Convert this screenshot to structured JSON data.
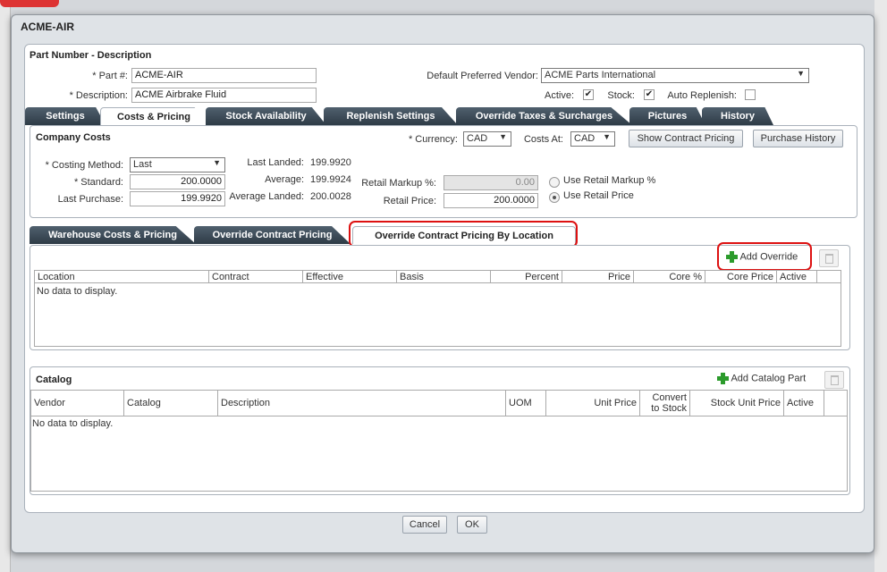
{
  "window": {
    "title": "ACME-AIR"
  },
  "part_section": {
    "title": "Part Number - Description",
    "part_label": "* Part #:",
    "part_value": "ACME-AIR",
    "desc_label": "* Description:",
    "desc_value": "ACME Airbrake Fluid",
    "vendor_label": "Default Preferred Vendor:",
    "vendor_value": "ACME Parts International",
    "active_label": "Active:",
    "stock_label": "Stock:",
    "auto_label": "Auto Replenish:"
  },
  "main_tabs": [
    "Settings",
    "Costs & Pricing",
    "Stock Availability",
    "Replenish Settings",
    "Override Taxes & Surcharges",
    "Pictures",
    "History"
  ],
  "company_costs": {
    "title": "Company Costs",
    "currency_label": "* Currency:",
    "currency_value": "CAD",
    "costs_at_label": "Costs At:",
    "costs_at_value": "CAD",
    "contract_btn": "Show Contract Pricing",
    "history_btn": "Purchase History",
    "costing_label": "* Costing Method:",
    "costing_value": "Last",
    "standard_label": "* Standard:",
    "standard_value": "200.0000",
    "last_purchase_label": "Last Purchase:",
    "last_purchase_value": "199.9920",
    "last_landed_label": "Last Landed:",
    "last_landed_value": "199.9920",
    "average_label": "Average:",
    "average_value": "199.9924",
    "avg_landed_label": "Average Landed:",
    "avg_landed_value": "200.0028",
    "markup_label": "Retail Markup %:",
    "markup_value": "0.00",
    "retail_label": "Retail Price:",
    "retail_value": "200.0000",
    "use_markup": "Use Retail Markup %",
    "use_price": "Use Retail Price"
  },
  "sub_tabs": [
    "Warehouse Costs & Pricing",
    "Override Contract Pricing",
    "Override Contract Pricing By Location"
  ],
  "override_grid": {
    "add_label": "Add Override",
    "columns": [
      "Location",
      "Contract",
      "Effective",
      "Basis",
      "Percent",
      "Price",
      "Core %",
      "Core Price",
      "Active"
    ],
    "empty": "No data to display."
  },
  "catalog": {
    "title": "Catalog",
    "add_label": "Add Catalog Part",
    "columns": [
      "Vendor",
      "Catalog",
      "Description",
      "UOM",
      "Unit Price",
      "Convert",
      "to Stock",
      "Stock Unit Price",
      "Active"
    ],
    "empty": "No data to display."
  },
  "footer": {
    "cancel": "Cancel",
    "ok": "OK"
  }
}
